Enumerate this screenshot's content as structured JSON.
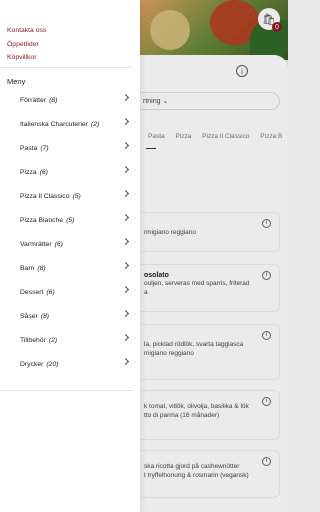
{
  "drawer": {
    "links": [
      "Kontakta oss",
      "Öppettider",
      "Köpvillkor"
    ],
    "menu_heading": "Meny",
    "categories": [
      {
        "label": "Förrätter",
        "count": "(8)"
      },
      {
        "label": "Italienska Charcuterier",
        "count": "(2)"
      },
      {
        "label": "Pasta",
        "count": "(7)"
      },
      {
        "label": "Pizza",
        "count": "(6)"
      },
      {
        "label": "Pizza Il Classico",
        "count": "(5)"
      },
      {
        "label": "Pizza Bianche",
        "count": "(5)"
      },
      {
        "label": "Varmrätter",
        "count": "(6)"
      },
      {
        "label": "Barn",
        "count": "(8)"
      },
      {
        "label": "Dessert",
        "count": "(6)"
      },
      {
        "label": "Såser",
        "count": "(8)"
      },
      {
        "label": "Tillbehör",
        "count": "(2)"
      },
      {
        "label": "Drycker",
        "count": "(20)"
      }
    ]
  },
  "background": {
    "cart_count": "0",
    "sort_label": "rtning",
    "tabs": [
      "Pasta",
      "Pizza",
      "Pizza Il Classico",
      "Pizza B"
    ],
    "cards": [
      {
        "title": "",
        "lines": [
          "rmigiano reggiano"
        ]
      },
      {
        "title": "osolato",
        "lines": [
          "ouljen, serveras med sparris, friterad",
          "a"
        ]
      },
      {
        "title": "",
        "lines": [
          "la, picklad rödlök, svarta taggiasca",
          "migiano reggiano"
        ]
      },
      {
        "title": "",
        "lines": [
          "k tomat, vitlök, olivolja, basilika & lök",
          "tto di parma (16 månader)"
        ]
      },
      {
        "title": "",
        "lines": [
          "ska ricotta gjord på cashewnötter",
          "t tryffelhonung & rosmarin (vegansk)"
        ]
      }
    ]
  },
  "colors": {
    "accent": "#8b1e2a"
  }
}
